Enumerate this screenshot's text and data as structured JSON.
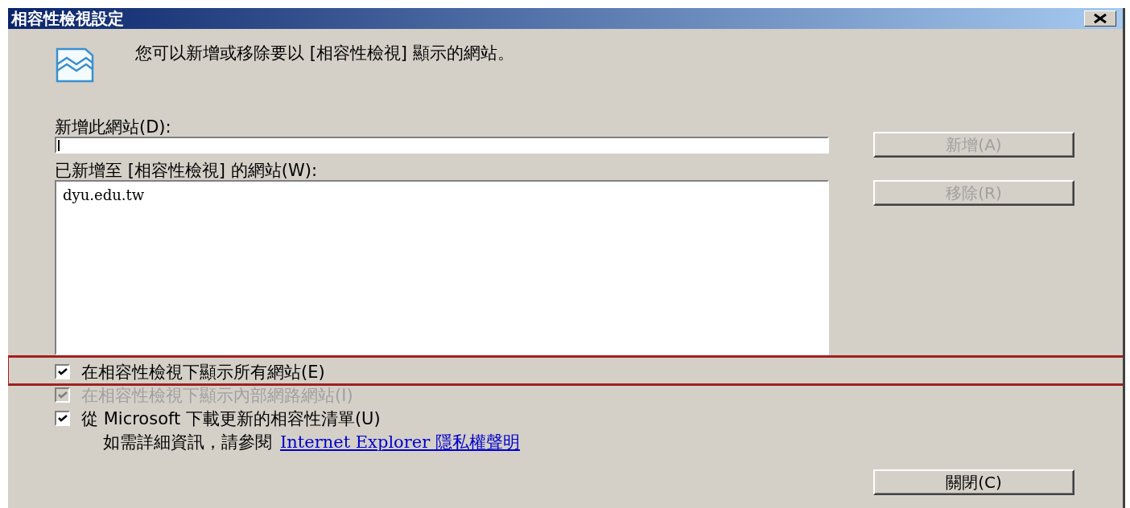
{
  "window": {
    "title": "相容性檢視設定"
  },
  "message": "您可以新增或移除要以 [相容性檢視] 顯示的網站。",
  "add_site": {
    "label": "新增此網站(D):",
    "button": {
      "label": "新增(A)",
      "disabled": true
    }
  },
  "site_list": {
    "label": "已新增至 [相容性檢視] 的網站(W):",
    "items": [
      {
        "text": "dyu.edu.tw",
        "selected": false
      }
    ],
    "button": {
      "label": "移除(R)",
      "disabled": true
    }
  },
  "options": [
    {
      "label": "在相容性檢視下顯示所有網站(E)",
      "checked": true,
      "disabled": false,
      "highlighted": true
    },
    {
      "label": "在相容性檢視下顯示內部網路網站(I)",
      "checked": true,
      "disabled": true,
      "highlighted": false
    },
    {
      "label": "從 Microsoft 下載更新的相容性清單(U)",
      "checked": true,
      "disabled": false,
      "highlighted": false
    }
  ],
  "info": {
    "text": "如需詳細資訊，請參閱",
    "link": "Internet Explorer 隱私權聲明"
  },
  "close_button": {
    "label": "關閉(C)"
  }
}
